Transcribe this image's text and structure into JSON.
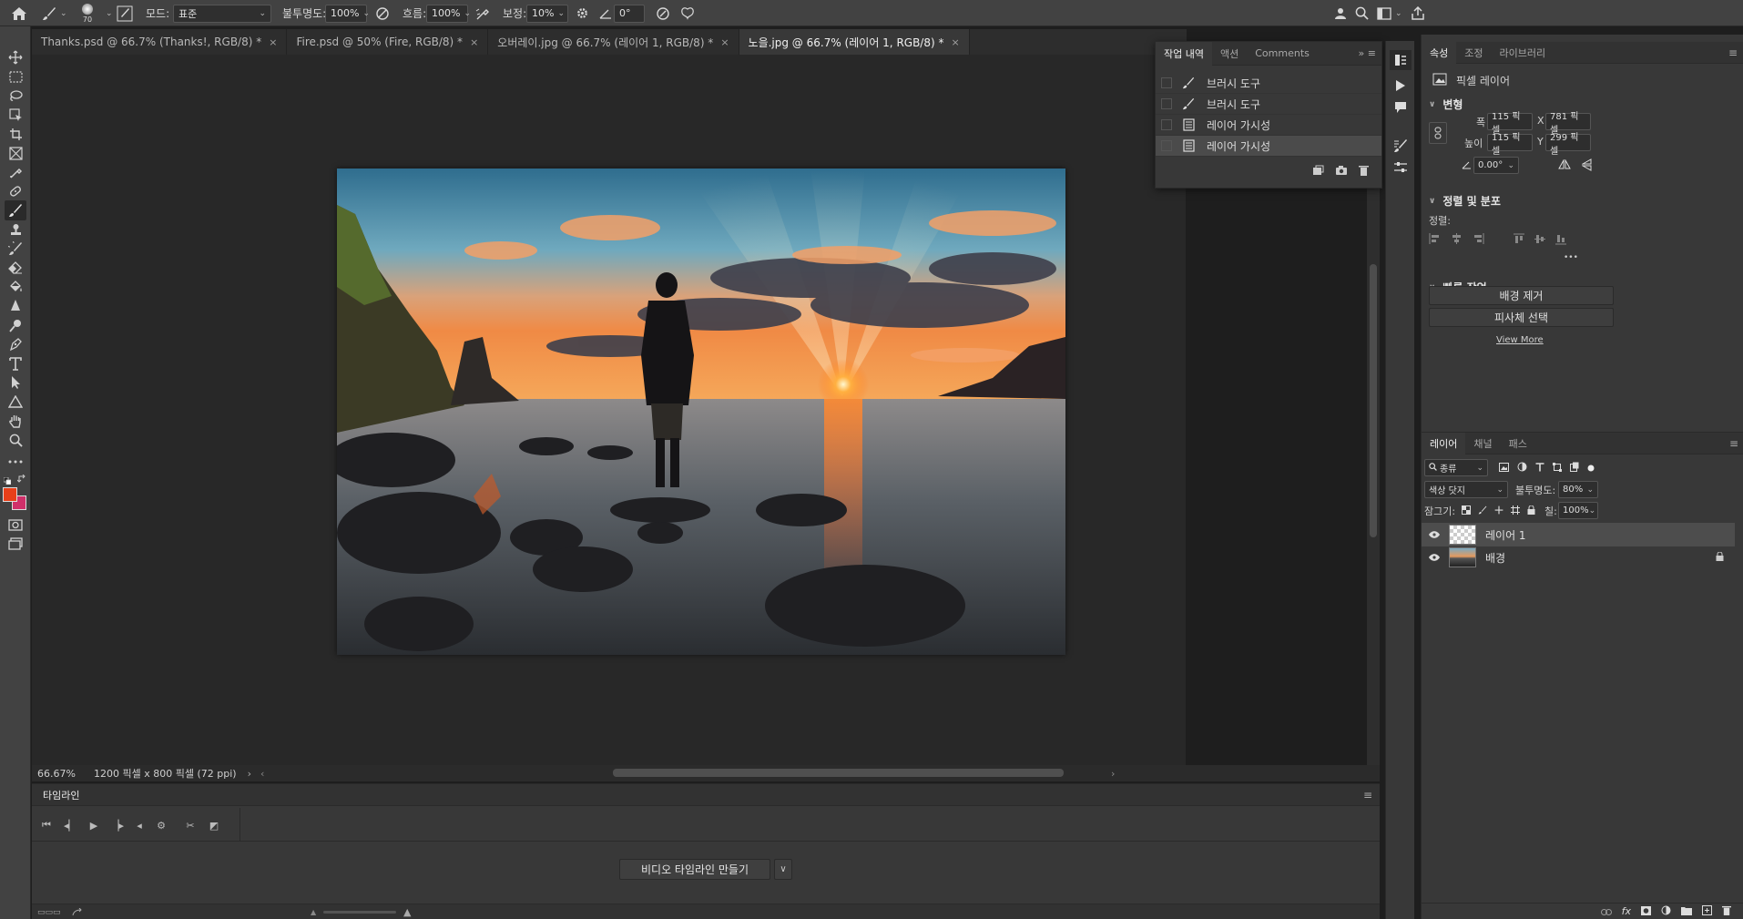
{
  "options_bar": {
    "brush_size": "70",
    "mode_label": "모드:",
    "mode_value": "표준",
    "opacity_label": "불투명도:",
    "opacity_value": "100%",
    "flow_label": "흐름:",
    "flow_value": "100%",
    "smoothing_label": "보정:",
    "smoothing_value": "10%",
    "angle_value": "0°"
  },
  "tabs": [
    {
      "label": "Thanks.psd @ 66.7% (Thanks!, RGB/8) *"
    },
    {
      "label": "Fire.psd @ 50% (Fire, RGB/8) *"
    },
    {
      "label": "오버레이.jpg @ 66.7% (레이어 1, RGB/8) *"
    },
    {
      "label": "노을.jpg @ 66.7% (레이어 1, RGB/8) *"
    }
  ],
  "status": {
    "zoom": "66.67%",
    "doc_info": "1200 픽셀 x 800 픽셀 (72 ppi)"
  },
  "history_panel": {
    "tabs": [
      "작업 내역",
      "액션",
      "Comments"
    ],
    "items": [
      {
        "label": "브러시 도구",
        "icon": "brush-icon"
      },
      {
        "label": "브러시 도구",
        "icon": "brush-icon"
      },
      {
        "label": "레이어 가시성",
        "icon": "document-icon"
      },
      {
        "label": "레이어 가시성",
        "icon": "document-icon"
      }
    ]
  },
  "properties": {
    "tabs": [
      "속성",
      "조정",
      "라이브러리"
    ],
    "layer_type": "픽셀 레이어",
    "transform_title": "변형",
    "w_label": "폭",
    "w_value": "115 픽셀",
    "h_label": "높이",
    "h_value": "115 픽셀",
    "x_label": "X",
    "x_value": "781 픽셀",
    "y_label": "Y",
    "y_value": "299 픽셀",
    "angle_value": "0.00°",
    "align_title": "정렬 및 분포",
    "align_label": "정렬:",
    "more": "•••",
    "quick_title": "빠른 작업",
    "remove_bg": "배경 제거",
    "select_subject": "피사체 선택",
    "view_more": "View More"
  },
  "layers": {
    "tabs": [
      "레이어",
      "채널",
      "패스"
    ],
    "filter_label": "종류",
    "blend_mode": "색상 닷지",
    "opacity_label": "불투명도:",
    "opacity_value": "80%",
    "lock_label": "잠그기:",
    "fill_label": "칠:",
    "fill_value": "100%",
    "items": [
      {
        "name": "레이어 1"
      },
      {
        "name": "배경"
      }
    ]
  },
  "timeline": {
    "title": "타임라인",
    "create_button": "비디오 타임라인 만들기"
  },
  "colors": {
    "foreground": "#e8401a",
    "background": "#d0306a"
  }
}
